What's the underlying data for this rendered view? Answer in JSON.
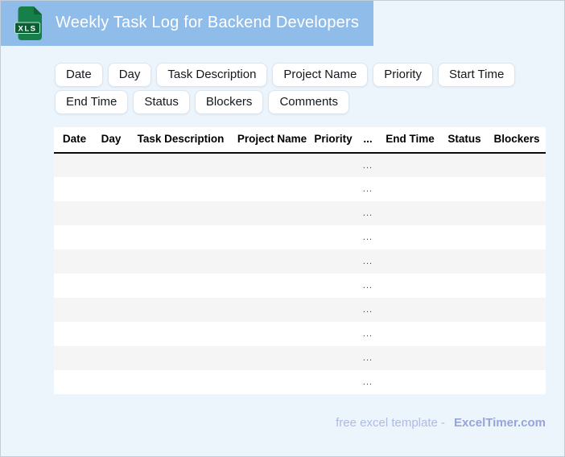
{
  "header": {
    "title": "Weekly Task Log for Backend Developers",
    "file_badge": "XLS"
  },
  "field_chips": [
    "Date",
    "Day",
    "Task Description",
    "Project Name",
    "Priority",
    "Start Time",
    "End Time",
    "Status",
    "Blockers",
    "Comments"
  ],
  "table": {
    "columns": [
      "Date",
      "Day",
      "Task Description",
      "Project Name",
      "Priority",
      "...",
      "End Time",
      "Status",
      "Blockers"
    ],
    "row_count": 10,
    "row_placeholder": "..."
  },
  "footer": {
    "prefix": "free excel template -",
    "brand": "ExcelTimer.com"
  },
  "colors": {
    "header_bg": "#90bce9",
    "page_bg": "#edf5fc",
    "icon_green": "#17804a",
    "icon_green_dark": "#0b5e33",
    "alt_row": "#f5f5f6",
    "footer_text": "#aeb9e6",
    "footer_brand": "#95a5da"
  }
}
